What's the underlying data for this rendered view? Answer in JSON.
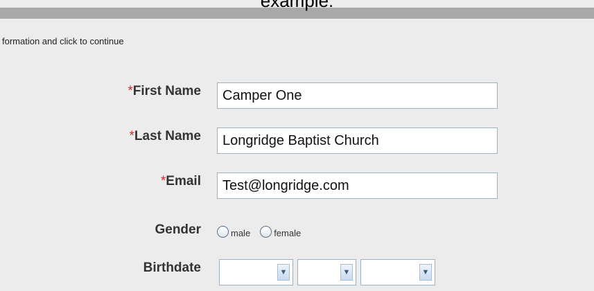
{
  "header": {
    "title": "example:"
  },
  "instructions": "formation and click to continue",
  "form": {
    "first_name": {
      "required_mark": "*",
      "label": "First Name",
      "value": "Camper One"
    },
    "last_name": {
      "required_mark": "*",
      "label": "Last Name",
      "value": "Longridge Baptist Church"
    },
    "email": {
      "required_mark": "*",
      "label": "Email",
      "value": "Test@longridge.com"
    },
    "gender": {
      "label": "Gender",
      "options": [
        "male",
        "female"
      ],
      "selected": null
    },
    "birthdate": {
      "label": "Birthdate",
      "month": "",
      "day": "",
      "year": "",
      "arrow_icon": "chevron-down-icon"
    }
  },
  "colors": {
    "required": "#d12c2c",
    "background": "#ececec",
    "header_bar": "#a9a9a9"
  }
}
